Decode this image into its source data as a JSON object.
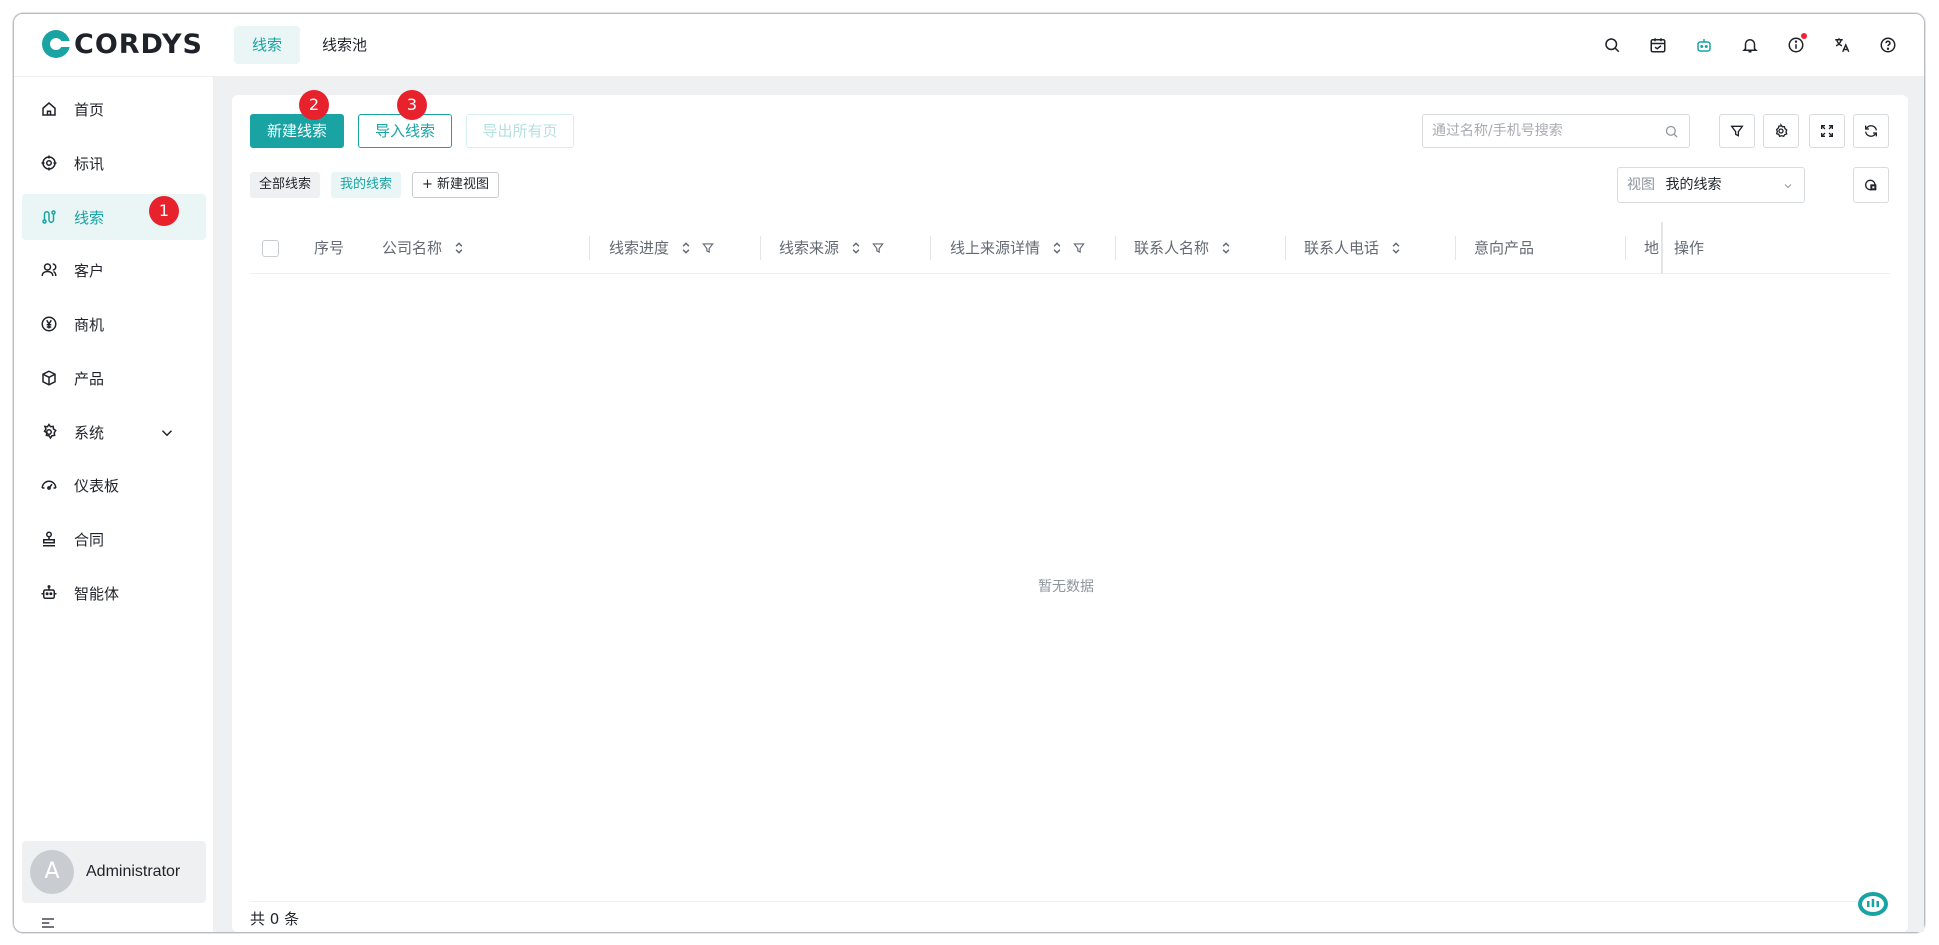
{
  "app": {
    "logo_text": "CORDYS"
  },
  "top_tabs": [
    {
      "label": "线索",
      "active": true
    },
    {
      "label": "线索池",
      "active": false
    }
  ],
  "header_icons": [
    "search-icon",
    "calendar-icon",
    "robot-icon",
    "bell-icon",
    "info-icon",
    "translate-icon",
    "help-icon"
  ],
  "sidebar": {
    "items": [
      {
        "label": "首页",
        "icon": "home-icon"
      },
      {
        "label": "标讯",
        "icon": "target-icon"
      },
      {
        "label": "线索",
        "icon": "lead-icon",
        "active": true
      },
      {
        "label": "客户",
        "icon": "customer-icon"
      },
      {
        "label": "商机",
        "icon": "yen-icon"
      },
      {
        "label": "产品",
        "icon": "box-icon"
      },
      {
        "label": "系统",
        "icon": "gear-icon"
      },
      {
        "label": "仪表板",
        "icon": "dashboard-icon"
      },
      {
        "label": "合同",
        "icon": "stamp-icon"
      },
      {
        "label": "智能体",
        "icon": "robot-icon"
      }
    ],
    "user": {
      "avatar_letter": "A",
      "name": "Administrator"
    }
  },
  "badges": [
    "1",
    "2",
    "3"
  ],
  "toolbar": {
    "new_lead": "新建线索",
    "import_lead": "导入线索",
    "export_all": "导出所有页",
    "search_placeholder": "通过名称/手机号搜索"
  },
  "views": {
    "all": "全部线索",
    "mine": "我的线索",
    "new_view": "新建视图",
    "select_label": "视图",
    "select_value": "我的线索"
  },
  "table": {
    "columns": [
      "序号",
      "公司名称",
      "线索进度",
      "线索来源",
      "线上来源详情",
      "联系人名称",
      "联系人电话",
      "意向产品",
      "地",
      "操作"
    ],
    "empty_text": "暂无数据",
    "total_text": "共 0 条"
  },
  "colors": {
    "accent": "#1aa3a3",
    "badge": "#e8222d"
  }
}
